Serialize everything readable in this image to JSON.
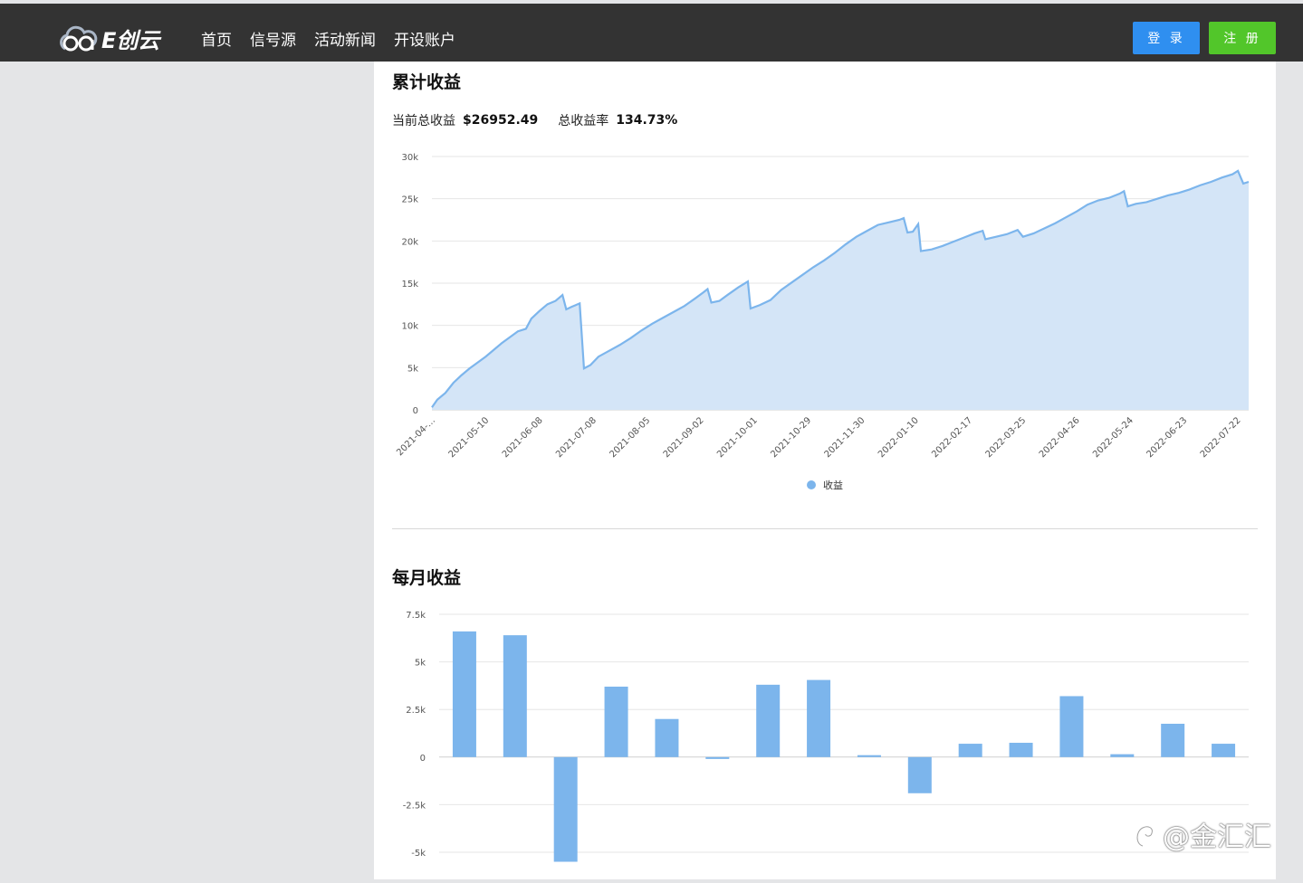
{
  "header": {
    "logo_text": "E创云",
    "nav": [
      "首页",
      "信号源",
      "活动新闻",
      "开设账户"
    ],
    "login_label": "登 录",
    "register_label": "注 册",
    "bg_color": "#333333",
    "login_color": "#2f8ff0",
    "register_color": "#52c62a"
  },
  "cumulative": {
    "title": "累计收益",
    "total_label": "当前总收益",
    "total_value": "$26952.49",
    "rate_label": "总收益率",
    "rate_value": "134.73%"
  },
  "monthly": {
    "title": "每月收益"
  },
  "watermark": "@金汇汇",
  "chart_data": [
    {
      "type": "area",
      "name": "cumulative-profit",
      "color": "#7cb5ec",
      "fill": "#d4e5f7",
      "ylim": [
        0,
        30000
      ],
      "yticks": [
        0,
        5000,
        10000,
        15000,
        20000,
        25000,
        30000
      ],
      "ytick_labels": [
        "0",
        "5k",
        "10k",
        "15k",
        "20k",
        "25k",
        "30k"
      ],
      "xtick_labels": [
        "2021-04-…",
        "2021-05-10",
        "2021-06-08",
        "2021-07-08",
        "2021-08-05",
        "2021-09-02",
        "2021-10-01",
        "2021-10-29",
        "2021-11-30",
        "2022-01-10",
        "2022-02-17",
        "2022-03-25",
        "2022-04-26",
        "2022-05-24",
        "2022-06-23",
        "2022-07-22"
      ],
      "legend": "收益",
      "legend_position": "bottom-center",
      "grid": true,
      "series": [
        {
          "name": "收益",
          "x_span": [
            0,
            15.2
          ],
          "points": [
            [
              0.0,
              300
            ],
            [
              0.1,
              1200
            ],
            [
              0.25,
              2000
            ],
            [
              0.4,
              3200
            ],
            [
              0.55,
              4100
            ],
            [
              0.7,
              4900
            ],
            [
              0.85,
              5600
            ],
            [
              1.0,
              6300
            ],
            [
              1.15,
              7100
            ],
            [
              1.3,
              7900
            ],
            [
              1.45,
              8600
            ],
            [
              1.6,
              9300
            ],
            [
              1.75,
              9600
            ],
            [
              1.85,
              10800
            ],
            [
              2.0,
              11700
            ],
            [
              2.15,
              12500
            ],
            [
              2.3,
              12900
            ],
            [
              2.43,
              13600
            ],
            [
              2.5,
              11900
            ],
            [
              2.6,
              12200
            ],
            [
              2.75,
              12600
            ],
            [
              2.83,
              4900
            ],
            [
              2.95,
              5300
            ],
            [
              3.1,
              6300
            ],
            [
              3.3,
              7000
            ],
            [
              3.5,
              7700
            ],
            [
              3.7,
              8500
            ],
            [
              3.9,
              9400
            ],
            [
              4.1,
              10200
            ],
            [
              4.3,
              10900
            ],
            [
              4.5,
              11600
            ],
            [
              4.7,
              12300
            ],
            [
              4.9,
              13200
            ],
            [
              5.05,
              13900
            ],
            [
              5.13,
              14300
            ],
            [
              5.2,
              12700
            ],
            [
              5.35,
              12900
            ],
            [
              5.5,
              13600
            ],
            [
              5.7,
              14500
            ],
            [
              5.88,
              15200
            ],
            [
              5.93,
              12000
            ],
            [
              6.1,
              12400
            ],
            [
              6.3,
              13000
            ],
            [
              6.5,
              14200
            ],
            [
              6.7,
              15100
            ],
            [
              6.9,
              16000
            ],
            [
              7.1,
              16900
            ],
            [
              7.3,
              17700
            ],
            [
              7.5,
              18600
            ],
            [
              7.7,
              19600
            ],
            [
              7.9,
              20500
            ],
            [
              8.1,
              21200
            ],
            [
              8.3,
              21900
            ],
            [
              8.5,
              22200
            ],
            [
              8.7,
              22500
            ],
            [
              8.78,
              22700
            ],
            [
              8.85,
              21000
            ],
            [
              8.95,
              21100
            ],
            [
              9.05,
              22000
            ],
            [
              9.1,
              18800
            ],
            [
              9.3,
              19000
            ],
            [
              9.5,
              19400
            ],
            [
              9.7,
              19900
            ],
            [
              9.9,
              20400
            ],
            [
              10.1,
              20900
            ],
            [
              10.25,
              21200
            ],
            [
              10.3,
              20200
            ],
            [
              10.5,
              20500
            ],
            [
              10.7,
              20800
            ],
            [
              10.9,
              21300
            ],
            [
              11.0,
              20500
            ],
            [
              11.2,
              20900
            ],
            [
              11.4,
              21500
            ],
            [
              11.6,
              22100
            ],
            [
              11.8,
              22800
            ],
            [
              12.0,
              23500
            ],
            [
              12.2,
              24300
            ],
            [
              12.4,
              24800
            ],
            [
              12.6,
              25100
            ],
            [
              12.8,
              25600
            ],
            [
              12.88,
              25900
            ],
            [
              12.95,
              24100
            ],
            [
              13.1,
              24400
            ],
            [
              13.3,
              24600
            ],
            [
              13.5,
              25000
            ],
            [
              13.7,
              25400
            ],
            [
              13.9,
              25700
            ],
            [
              14.1,
              26100
            ],
            [
              14.3,
              26600
            ],
            [
              14.5,
              27000
            ],
            [
              14.7,
              27500
            ],
            [
              14.9,
              27900
            ],
            [
              15.0,
              28300
            ],
            [
              15.1,
              26800
            ],
            [
              15.2,
              27000
            ]
          ]
        }
      ]
    },
    {
      "type": "bar",
      "name": "monthly-profit",
      "color": "#7cb5ec",
      "ylim": [
        -5000,
        7500
      ],
      "yticks": [
        -5000,
        -2500,
        0,
        2500,
        5000,
        7500
      ],
      "ytick_labels": [
        "-5k",
        "-2.5k",
        "0",
        "2.5k",
        "5k",
        "7.5k"
      ],
      "grid": true,
      "values": [
        6600,
        6400,
        -5500,
        3700,
        2000,
        -100,
        3800,
        4050,
        100,
        -1900,
        700,
        750,
        3200,
        150,
        1750,
        700
      ]
    }
  ]
}
